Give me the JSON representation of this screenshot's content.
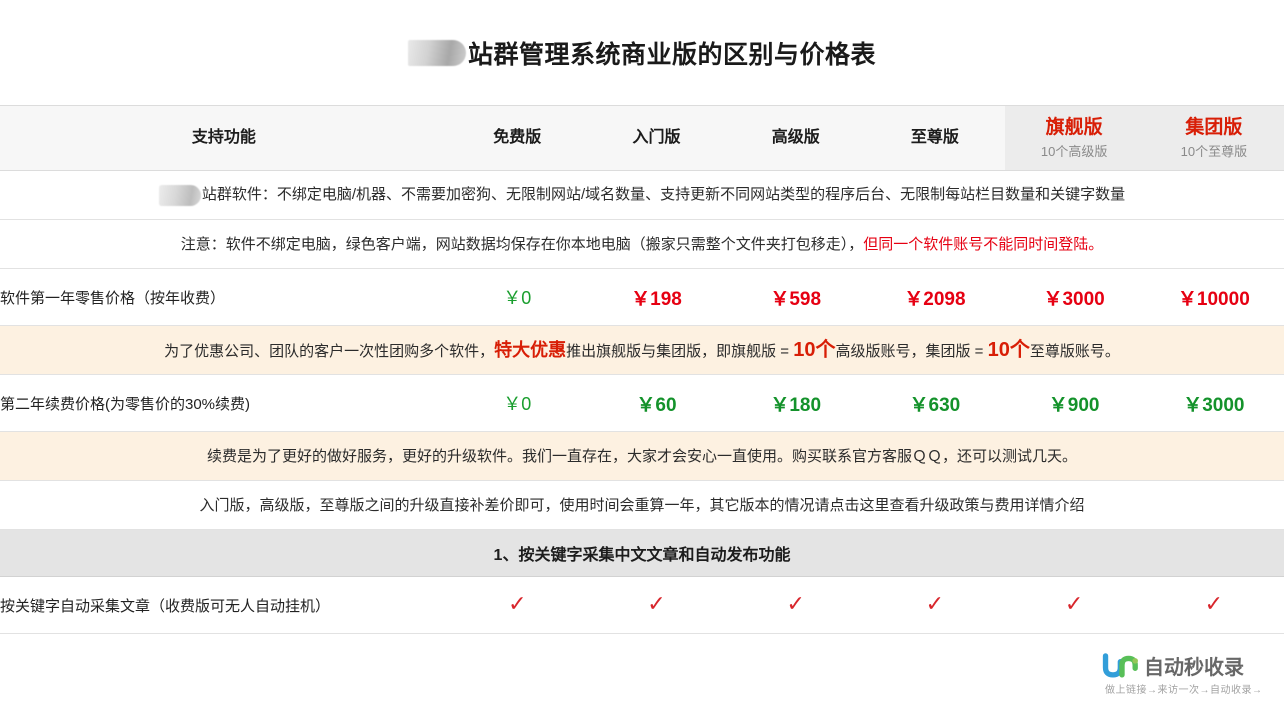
{
  "title": {
    "redacted_prefix": true,
    "text": "站群管理系统商业版的区别与价格表"
  },
  "table": {
    "columns": [
      {
        "key": "feature",
        "label": "支持功能",
        "sub": "",
        "style": "normal"
      },
      {
        "key": "free",
        "label": "免费版",
        "sub": "",
        "style": "normal"
      },
      {
        "key": "starter",
        "label": "入门版",
        "sub": "",
        "style": "normal"
      },
      {
        "key": "advanced",
        "label": "高级版",
        "sub": "",
        "style": "normal"
      },
      {
        "key": "supreme",
        "label": "至尊版",
        "sub": "",
        "style": "normal"
      },
      {
        "key": "flagship",
        "label": "旗舰版",
        "sub": "10个高级版",
        "style": "red"
      },
      {
        "key": "group",
        "label": "集团版",
        "sub": "10个至尊版",
        "style": "red"
      }
    ],
    "notes": {
      "software_desc_prefix_redacted": true,
      "software_desc": "站群软件：不绑定电脑/机器、不需要加密狗、无限制网站/域名数量、支持更新不同网站类型的程序后台、无限制每站栏目数量和关键字数量",
      "attention_black": "注意：软件不绑定电脑，绿色客户端，网站数据均保存在你本地电脑（搬家只需整个文件夹打包移走），",
      "attention_red": "但同一个软件账号不能同时间登陆。",
      "promo_part1": "为了优惠公司、团队的客户一次性团购多个软件，",
      "promo_emph1": "特大优惠",
      "promo_part2": "推出旗舰版与集团版，即旗舰版 = ",
      "promo_emph2": "10个",
      "promo_part3": "高级版账号，集团版 = ",
      "promo_emph3": "10个",
      "promo_part4": "至尊版账号。",
      "renew_service": "续费是为了更好的做好服务，更好的升级软件。我们一直存在，大家才会安心一直使用。购买联系官方客服ＱＱ，还可以测试几天。",
      "upgrade_policy": "入门版，高级版，至尊版之间的升级直接补差价即可，使用时间会重算一年，其它版本的情况请点击这里查看升级政策与费用详情介绍"
    },
    "price_rows": [
      {
        "label": "软件第一年零售价格（按年收费）",
        "color": "red",
        "values": [
          "￥0",
          "￥198",
          "￥598",
          "￥2098",
          "￥3000",
          "￥10000"
        ]
      },
      {
        "label": "第二年续费价格(为零售价的30%续费)",
        "color": "green",
        "values": [
          "￥0",
          "￥60",
          "￥180",
          "￥630",
          "￥900",
          "￥3000"
        ]
      }
    ],
    "sections": [
      {
        "heading": "1、按关键字采集中文文章和自动发布功能",
        "rows": [
          {
            "label": "按关键字自动采集文章（收费版可无人自动挂机）",
            "marks": [
              "✓",
              "✓",
              "✓",
              "✓",
              "✓",
              "✓"
            ]
          }
        ]
      }
    ]
  },
  "watermark": {
    "word": "自动秒收录",
    "tagline": "做上链接→来访一次→自动收录→"
  },
  "colors": {
    "accent_red": "#d81e06",
    "price_red": "#e60012",
    "price_green": "#14922b",
    "free_green": "#1a9e2e",
    "cream_bg": "#fdf1e1",
    "header_bg": "#f7f7f7",
    "section_bg": "#e4e4e4"
  }
}
